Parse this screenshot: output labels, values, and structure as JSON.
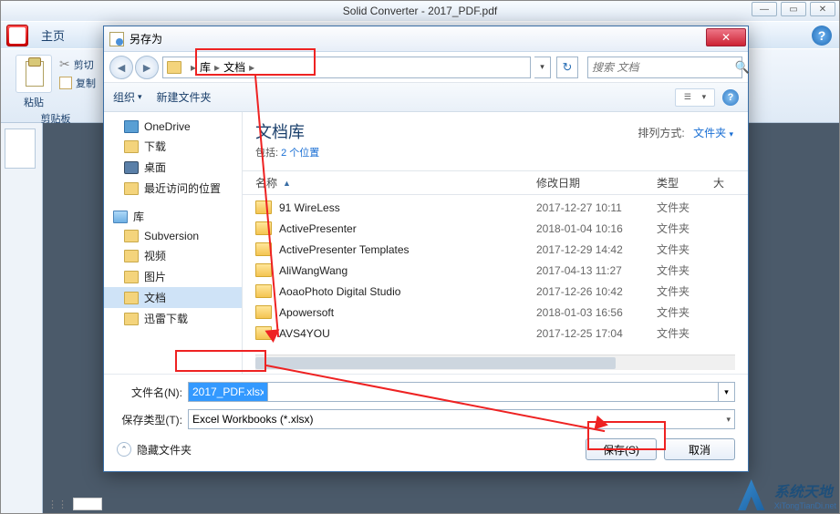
{
  "outer": {
    "title": "Solid Converter - 2017_PDF.pdf",
    "tab_home": "主页",
    "help_glyph": "?"
  },
  "ribbon": {
    "paste": "粘贴",
    "cut": "剪切",
    "copy": "复制",
    "group_clip": "剪贴板"
  },
  "dialog": {
    "title": "另存为",
    "breadcrumb": {
      "root": "库",
      "folder": "文档"
    },
    "search_placeholder": "搜索 文档",
    "organize": "组织",
    "new_folder": "新建文件夹",
    "panel_title": "文档库",
    "panel_sub_prefix": "包括: ",
    "panel_sub_link": "2 个位置",
    "sort_label": "排列方式:",
    "sort_value": "文件夹",
    "columns": {
      "name": "名称",
      "date": "修改日期",
      "type": "类型",
      "size": "大"
    },
    "filename_label": "文件名(N):",
    "filename_value": "2017_PDF.xlsx",
    "filetype_label": "保存类型(T):",
    "filetype_value": "Excel Workbooks (*.xlsx)",
    "hide_folders": "隐藏文件夹",
    "save_btn": "保存(S)",
    "cancel_btn": "取消"
  },
  "sidebar": [
    {
      "label": "OneDrive",
      "icon": "blue"
    },
    {
      "label": "下载",
      "icon": "folder"
    },
    {
      "label": "桌面",
      "icon": "desk"
    },
    {
      "label": "最近访问的位置",
      "icon": "folder"
    },
    {
      "label": "库",
      "icon": "lib",
      "header": true
    },
    {
      "label": "Subversion",
      "icon": "folder"
    },
    {
      "label": "视频",
      "icon": "folder"
    },
    {
      "label": "图片",
      "icon": "folder"
    },
    {
      "label": "文档",
      "icon": "folder",
      "selected": true
    },
    {
      "label": "迅雷下载",
      "icon": "folder"
    }
  ],
  "files": [
    {
      "name": "91 WireLess",
      "date": "2017-12-27 10:11",
      "type": "文件夹"
    },
    {
      "name": "ActivePresenter",
      "date": "2018-01-04 10:16",
      "type": "文件夹"
    },
    {
      "name": "ActivePresenter Templates",
      "date": "2017-12-29 14:42",
      "type": "文件夹"
    },
    {
      "name": "AliWangWang",
      "date": "2017-04-13 11:27",
      "type": "文件夹"
    },
    {
      "name": "AoaoPhoto Digital Studio",
      "date": "2017-12-26 10:42",
      "type": "文件夹"
    },
    {
      "name": "Apowersoft",
      "date": "2018-01-03 16:56",
      "type": "文件夹"
    },
    {
      "name": "AVS4YOU",
      "date": "2017-12-25 17:04",
      "type": "文件夹"
    }
  ],
  "watermark": {
    "text": "系统天地",
    "url": "XiTongTianDi.net"
  }
}
